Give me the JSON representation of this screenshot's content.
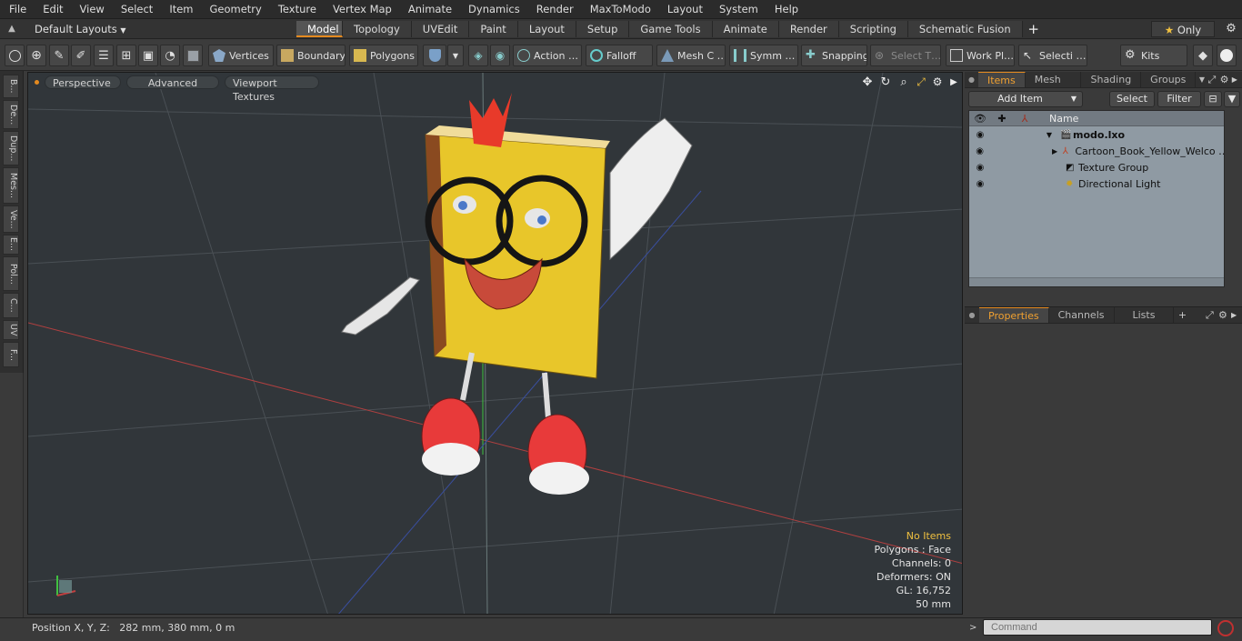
{
  "menu": [
    "File",
    "Edit",
    "View",
    "Select",
    "Item",
    "Geometry",
    "Texture",
    "Vertex Map",
    "Animate",
    "Dynamics",
    "Render",
    "MaxToModo",
    "Layout",
    "System",
    "Help"
  ],
  "layouts": {
    "default_label": "Default Layouts",
    "tabs": [
      "Model",
      "Topology",
      "UVEdit",
      "Paint",
      "Layout",
      "Setup",
      "Game Tools",
      "Animate",
      "Render",
      "Scripting",
      "Schematic Fusion"
    ],
    "add": "+",
    "only_label": "Only",
    "star": "★"
  },
  "toolbar": {
    "vertices": "Vertices",
    "boundary": "Boundary",
    "polygons": "Polygons",
    "action": "Action …",
    "falloff": "Falloff",
    "mesh": "Mesh C …",
    "symm": "Symm …",
    "snapping": "Snapping",
    "select_t": "Select T…",
    "work_pl": "Work Pl…",
    "selecti": "Selecti …",
    "kits": "Kits"
  },
  "left_tabs": [
    "B...",
    "De...",
    "Dup...",
    "Mes...",
    "Ve...",
    "E...",
    "Pol...",
    "C...",
    "UV",
    "F..."
  ],
  "viewport": {
    "perspective": "Perspective",
    "advanced": "Advanced",
    "textures": "Viewport Textures",
    "info": {
      "items": "No Items",
      "polygons": "Polygons : Face",
      "channels": "Channels: 0",
      "deformers": "Deformers: ON",
      "gl": "GL: 16,752",
      "scale": "50 mm"
    }
  },
  "items_panel": {
    "tabs": [
      "Items",
      "Mesh …",
      "Shading",
      "Groups"
    ],
    "add_item": "Add Item",
    "select": "Select",
    "filter": "Filter",
    "name_header": "Name",
    "rows": [
      {
        "label": "modo.lxo"
      },
      {
        "label": "Cartoon_Book_Yellow_Welco …"
      },
      {
        "label": "Texture Group"
      },
      {
        "label": "Directional Light"
      }
    ]
  },
  "props_panel": {
    "tabs": [
      "Properties",
      "Channels",
      "Lists"
    ],
    "add": "+"
  },
  "status": {
    "position": "Position X, Y, Z:   282 mm, 380 mm, 0 m",
    "command_placeholder": "Command"
  },
  "colors": {
    "accent": "#e58a1f",
    "viewport_bg": "#31363a",
    "itemlist_bg": "#8f9aa3"
  }
}
